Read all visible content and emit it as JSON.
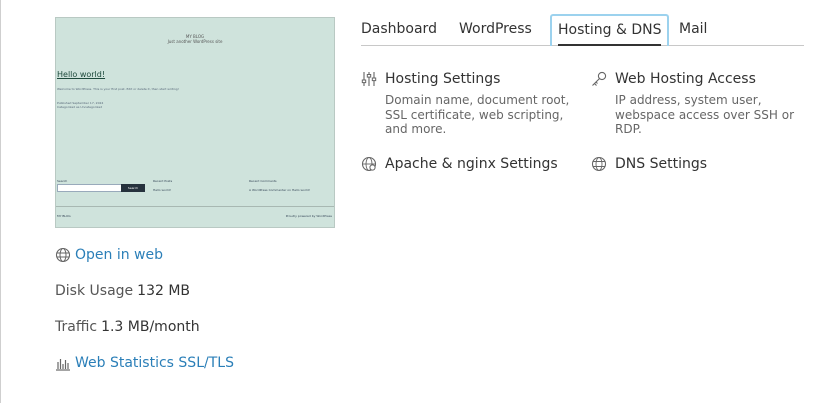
{
  "preview": {
    "site_name": "MY BLOG",
    "site_tagline": "Just another WordPress site",
    "post_title": "Hello world!",
    "post_text": "Welcome to WordPress. This is your first post. Edit or delete it, then start writing!",
    "post_meta_1": "Published September 17, 2024",
    "post_meta_2": "Categorized as Uncategorized",
    "search_label": "Search",
    "search_button": "Search",
    "recent_posts_label": "Recent Posts",
    "recent_post_1": "Hello world!",
    "recent_comments_label": "Recent Comments",
    "recent_comment_1": "A WordPress Commenter on Hello world!",
    "footer_left": "MY BLOG",
    "footer_right": "Proudly powered by WordPress"
  },
  "site_info": {
    "open_in_web": "Open in web",
    "disk_usage_label": "Disk Usage",
    "disk_usage_value": "132 MB",
    "traffic_label": "Traffic",
    "traffic_value": "1.3 MB/month",
    "web_stats": "Web Statistics SSL/TLS"
  },
  "tabs": [
    {
      "label": "Dashboard",
      "active": false
    },
    {
      "label": "WordPress",
      "active": false
    },
    {
      "label": "Hosting & DNS",
      "active": true
    },
    {
      "label": "Mail",
      "active": false
    }
  ],
  "hosting": {
    "hosting_settings": {
      "title": "Hosting Settings",
      "description": "Domain name, document root, SSL certificate, web scripting, and more."
    },
    "web_hosting_access": {
      "title": "Web Hosting Access",
      "description": "IP address, system user, webspace access over SSH or RDP."
    },
    "apache_nginx": {
      "title": "Apache & nginx Settings"
    },
    "dns_settings": {
      "title": "DNS Settings"
    }
  },
  "icons": {
    "open_in_web": "globe-icon",
    "web_stats": "bar-chart-icon",
    "hosting_settings": "sliders-icon",
    "web_hosting_access": "key-icon",
    "apache_nginx": "gear-globe-icon",
    "dns_settings": "dns-globe-icon"
  },
  "colors": {
    "link": "#2b7fb8",
    "active_tab_outline": "#9cd2ee",
    "preview_bg": "#cfe3dc"
  }
}
